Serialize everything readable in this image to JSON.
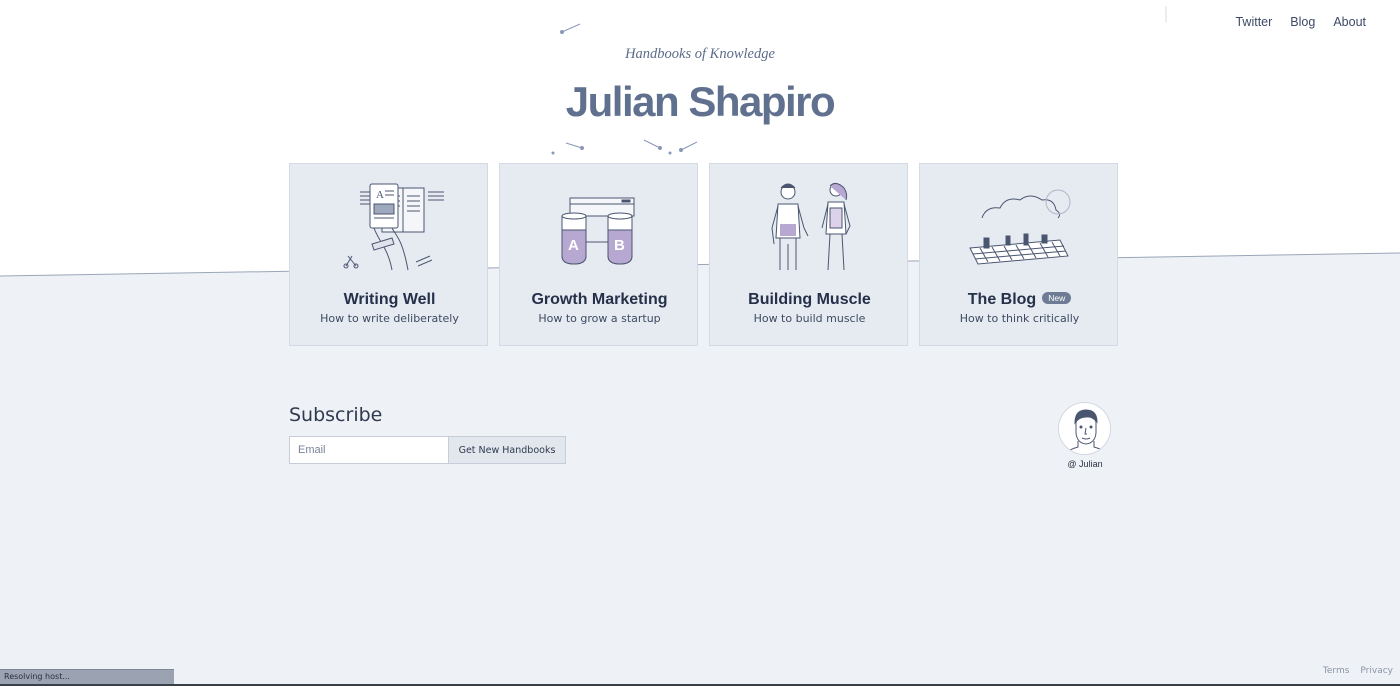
{
  "nav": {
    "items": [
      {
        "label": "Twitter"
      },
      {
        "label": "Blog"
      },
      {
        "label": "About"
      }
    ]
  },
  "hero": {
    "tagline": "Handbooks of Knowledge",
    "title": "Julian Shapiro"
  },
  "cards": [
    {
      "title": "Writing Well",
      "subtitle": "How to write deliberately",
      "icon": "reading-tablet-illustration"
    },
    {
      "title": "Growth Marketing",
      "subtitle": "How to grow a startup",
      "icon": "ab-test-beakers-illustration"
    },
    {
      "title": "Building Muscle",
      "subtitle": "How to build muscle",
      "icon": "man-woman-fitness-illustration"
    },
    {
      "title": "The Blog",
      "subtitle": "How to think critically",
      "badge": "New",
      "icon": "rooftop-city-illustration"
    }
  ],
  "subscribe": {
    "heading": "Subscribe",
    "email_placeholder": "Email",
    "button_label": "Get New Handbooks"
  },
  "author": {
    "handle": "@ Julian"
  },
  "footer": {
    "links": [
      {
        "label": "Terms"
      },
      {
        "label": "Privacy"
      }
    ]
  },
  "status_bar": {
    "text": "Resolving host..."
  },
  "colors": {
    "page_background": "#eef1f5",
    "hero_background": "#ffffff",
    "card_background": "#e6ebf2",
    "title_color": "#60708f"
  }
}
